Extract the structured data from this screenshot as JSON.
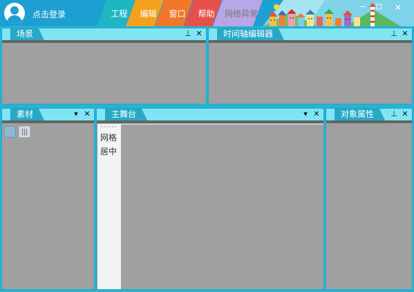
{
  "header": {
    "login_label": "点击登录",
    "menu": [
      "工程",
      "编辑",
      "窗口",
      "帮助"
    ],
    "network_status": "网络异常",
    "window_controls": {
      "minimize": "—",
      "maximize": "□",
      "close": "✕"
    }
  },
  "panels": {
    "scene": {
      "title": "场景",
      "pin": "⊥",
      "close": "✕"
    },
    "timeline": {
      "title": "时间轴编辑器",
      "pin": "⊥",
      "close": "✕"
    },
    "materials": {
      "title": "素材",
      "dropdown": "▾",
      "close": "✕"
    },
    "stage": {
      "title": "主舞台",
      "dropdown": "▾",
      "close": "✕",
      "side_items": [
        "网格",
        "居中"
      ]
    },
    "properties": {
      "title": "对象属性",
      "pin": "⊥",
      "close": "✕"
    }
  },
  "colors": {
    "top_bar": "#1e9fd2",
    "menu_project": "#1fb6c4",
    "menu_edit": "#f4a21e",
    "menu_window": "#f1782a",
    "menu_help": "#e4514a",
    "panel_bg": "#a0a0a0",
    "panel_tab": "#27a9c6",
    "panel_header": "#7fe5f4"
  }
}
